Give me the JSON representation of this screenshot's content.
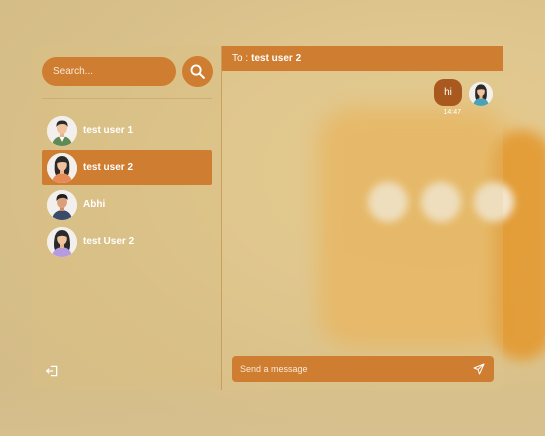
{
  "sidebar": {
    "search": {
      "placeholder": "Search...",
      "value": ""
    },
    "users": [
      {
        "name": "test user 1",
        "avatar": "male-avatar-green-shirt",
        "active": false
      },
      {
        "name": "test user 2",
        "avatar": "female-avatar-orange-top",
        "active": true
      },
      {
        "name": "Abhi",
        "avatar": "male-avatar-navy-shirt",
        "active": false
      },
      {
        "name": "test User 2",
        "avatar": "female-avatar-purple-top",
        "active": false
      }
    ],
    "logout_icon": "logout-icon"
  },
  "chat": {
    "header": {
      "prefix": "To :",
      "recipient": "test user 2"
    },
    "messages": [
      {
        "text": "hi",
        "time": "14:47",
        "from_self": true
      }
    ],
    "composer": {
      "placeholder": "Send a message",
      "value": ""
    },
    "send_icon": "send-icon"
  },
  "colors": {
    "accent": "#cf7d30",
    "bubble": "#a9581e",
    "background": "#dcc38c"
  }
}
